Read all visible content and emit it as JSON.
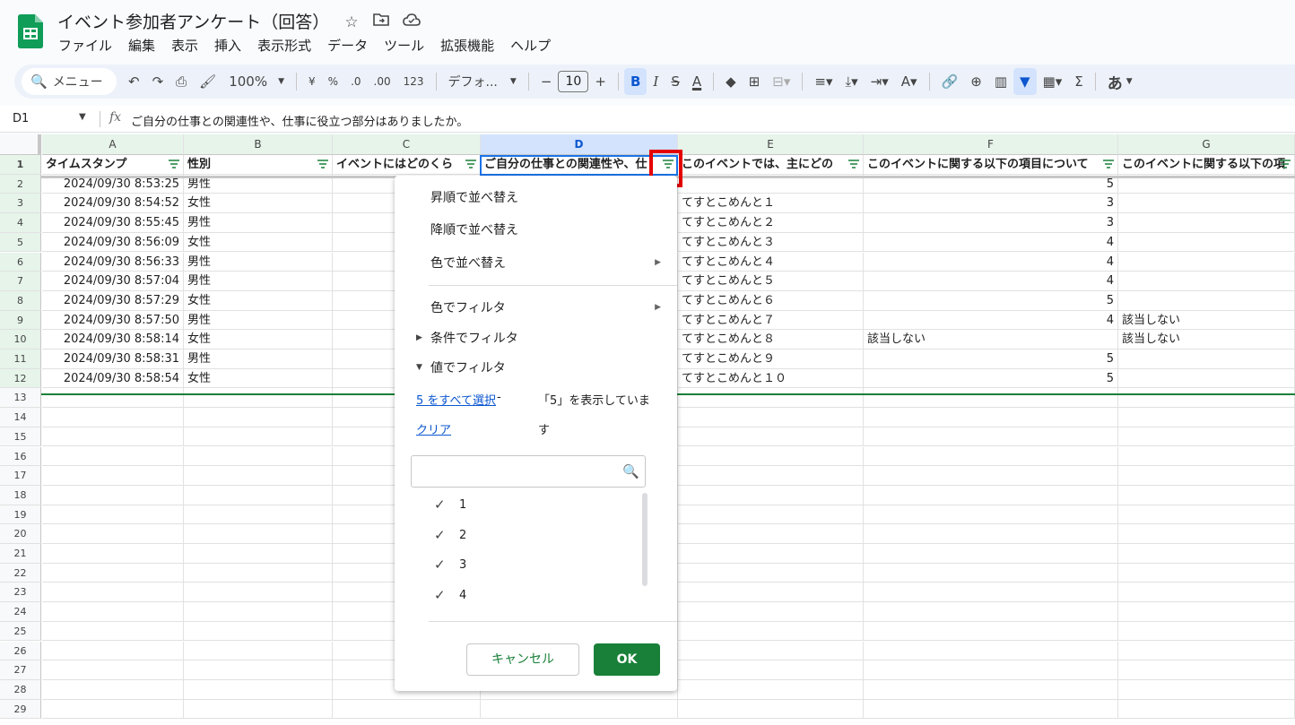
{
  "document": {
    "title": "イベント参加者アンケート（回答）",
    "star_icon": "star-icon",
    "move_icon": "folder-move-icon",
    "cloud_icon": "cloud-status-icon"
  },
  "menubar": [
    "ファイル",
    "編集",
    "表示",
    "挿入",
    "表示形式",
    "データ",
    "ツール",
    "拡張機能",
    "ヘルプ"
  ],
  "toolbar": {
    "search_label": "メニュー",
    "zoom": "100%",
    "currency": "¥",
    "percent": "%",
    "dec_decrease": ".0",
    "dec_increase": ".00",
    "number_format": "123",
    "font": "デフォ...",
    "font_size": "10",
    "bold": "B",
    "italic": "I",
    "strike": "S",
    "text_color": "A",
    "input_tool": "あ"
  },
  "formula_bar": {
    "name_box": "D1",
    "fx": "fx",
    "content": "ご自分の仕事との関連性や、仕事に役立つ部分はありましたか。"
  },
  "columns": [
    "A",
    "B",
    "C",
    "D",
    "E",
    "F",
    "G"
  ],
  "header_row": [
    "タイムスタンプ",
    "性別",
    "イベントにはどのくら",
    "ご自分の仕事との関連性や、仕",
    "このイベントでは、主にどの",
    "このイベントに関する以下の項目について",
    "このイベントに関する以下の項"
  ],
  "rows": [
    {
      "a": "2024/09/30 8:53:25",
      "b": "男性",
      "e": "",
      "f": "5",
      "g": ""
    },
    {
      "a": "2024/09/30 8:54:52",
      "b": "女性",
      "e": "てすとこめんと１",
      "f": "3",
      "g": ""
    },
    {
      "a": "2024/09/30 8:55:45",
      "b": "男性",
      "e": "てすとこめんと２",
      "f": "3",
      "g": ""
    },
    {
      "a": "2024/09/30 8:56:09",
      "b": "女性",
      "e": "てすとこめんと３",
      "f": "4",
      "g": ""
    },
    {
      "a": "2024/09/30 8:56:33",
      "b": "男性",
      "e": "てすとこめんと４",
      "f": "4",
      "g": ""
    },
    {
      "a": "2024/09/30 8:57:04",
      "b": "男性",
      "e": "てすとこめんと５",
      "f": "4",
      "g": ""
    },
    {
      "a": "2024/09/30 8:57:29",
      "b": "女性",
      "e": "てすとこめんと６",
      "f": "5",
      "g": ""
    },
    {
      "a": "2024/09/30 8:57:50",
      "b": "男性",
      "e": "てすとこめんと７",
      "f": "4",
      "g": "該当しない"
    },
    {
      "a": "2024/09/30 8:58:14",
      "b": "女性",
      "e": "てすとこめんと８",
      "f": "該当しない",
      "g": "該当しない"
    },
    {
      "a": "2024/09/30 8:58:31",
      "b": "男性",
      "e": "てすとこめんと９",
      "f": "5",
      "g": ""
    },
    {
      "a": "2024/09/30 8:58:54",
      "b": "女性",
      "e": "てすとこめんと１０",
      "f": "5",
      "g": ""
    }
  ],
  "row_numbers": [
    "1",
    "2",
    "3",
    "4",
    "5",
    "6",
    "7",
    "8",
    "9",
    "10",
    "11",
    "12",
    "13",
    "14",
    "15",
    "16",
    "17",
    "18",
    "19",
    "20",
    "21",
    "22",
    "23",
    "24",
    "25",
    "26",
    "27",
    "28",
    "29"
  ],
  "filter_menu": {
    "sort_asc": "昇順で並べ替え",
    "sort_desc": "降順で並べ替え",
    "sort_color": "色で並べ替え",
    "filter_color": "色でフィルタ",
    "filter_condition": "条件でフィルタ",
    "filter_values": "値でフィルタ",
    "select_all": "5 をすべて選択",
    "select_all_dash": "-",
    "showing_line1": "「5」を表示していま",
    "clear": "クリア",
    "showing_line2": "す",
    "values": [
      {
        "label": "1",
        "checked": true
      },
      {
        "label": "2",
        "checked": true
      },
      {
        "label": "3",
        "checked": true
      },
      {
        "label": "4",
        "checked": true
      }
    ],
    "cancel": "キャンセル",
    "ok": "OK"
  }
}
